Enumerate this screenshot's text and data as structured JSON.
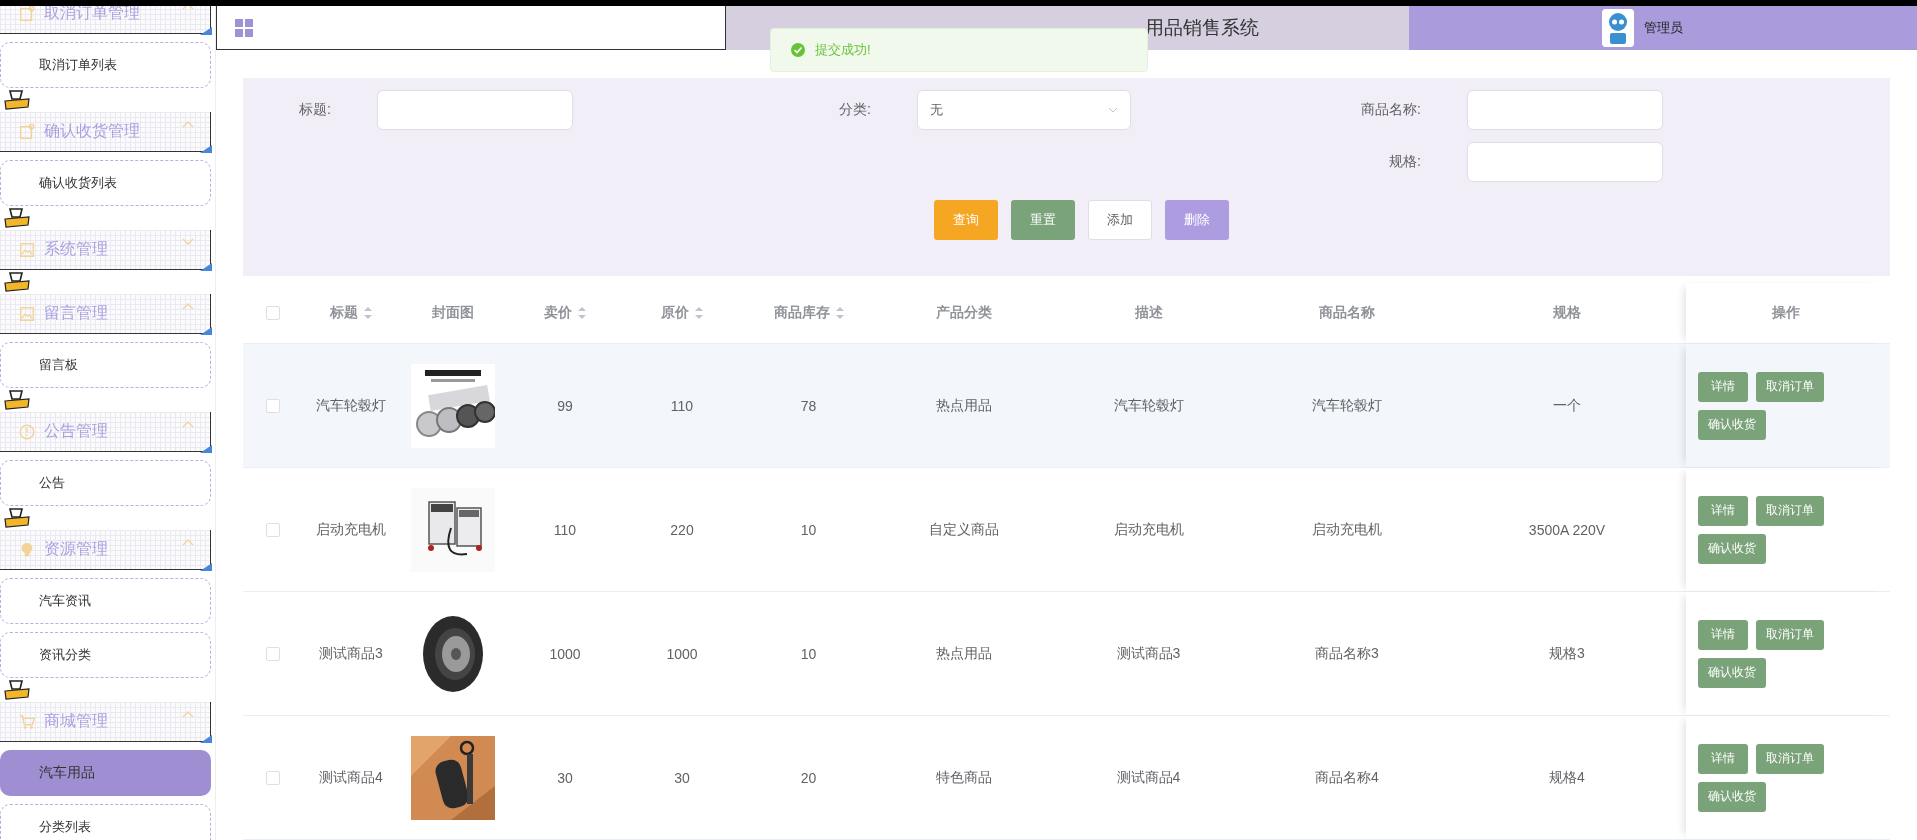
{
  "sidebar": {
    "groups": [
      {
        "title": "取消订单管理",
        "expanded": true,
        "items": [
          {
            "label": "取消订单列表",
            "selected": false
          }
        ]
      },
      {
        "title": "确认收货管理",
        "expanded": true,
        "items": [
          {
            "label": "确认收货列表",
            "selected": false
          }
        ]
      },
      {
        "title": "系统管理",
        "expanded": false
      },
      {
        "title": "留言管理",
        "expanded": true,
        "items": [
          {
            "label": "留言板",
            "selected": false
          }
        ]
      },
      {
        "title": "公告管理",
        "expanded": true,
        "items": [
          {
            "label": "公告",
            "selected": false
          }
        ]
      },
      {
        "title": "资源管理",
        "expanded": true,
        "items": [
          {
            "label": "汽车资讯",
            "selected": false
          },
          {
            "label": "资讯分类",
            "selected": false
          }
        ]
      },
      {
        "title": "商城管理",
        "expanded": true,
        "items": [
          {
            "label": "汽车用品",
            "selected": true
          },
          {
            "label": "分类列表",
            "selected": false
          }
        ]
      }
    ]
  },
  "header": {
    "title": "用品销售系统",
    "user": "管理员"
  },
  "toast": {
    "message": "提交成功!"
  },
  "filters": {
    "fields": [
      {
        "kind": "input",
        "label": "标题:"
      },
      {
        "kind": "select",
        "label": "分类:",
        "value": "无"
      },
      {
        "kind": "input",
        "label": "商品名称:"
      },
      {
        "kind": "input",
        "label": "规格:"
      }
    ],
    "buttons": [
      {
        "kind": "query",
        "label": "查询"
      },
      {
        "kind": "reset",
        "label": "重置"
      },
      {
        "kind": "add",
        "label": "添加"
      },
      {
        "kind": "delete",
        "label": "删除"
      }
    ]
  },
  "table": {
    "all_checked": false,
    "columns": [
      {
        "label": "标题",
        "sortable": true
      },
      {
        "label": "封面图",
        "sortable": false
      },
      {
        "label": "卖价",
        "sortable": true
      },
      {
        "label": "原价",
        "sortable": true
      },
      {
        "label": "商品库存",
        "sortable": true
      },
      {
        "label": "产品分类",
        "sortable": false
      },
      {
        "label": "描述",
        "sortable": false
      },
      {
        "label": "商品名称",
        "sortable": false
      },
      {
        "label": "规格",
        "sortable": false
      }
    ],
    "actions_label": "操作",
    "rows": [
      {
        "checked": false,
        "hovered": true,
        "cells": [
          "汽车轮毂灯",
          "",
          "99",
          "110",
          "78",
          "热点用品",
          "汽车轮毂灯",
          "汽车轮毂灯",
          "一个"
        ],
        "actions": [
          "详情",
          "取消订单",
          "确认收货"
        ]
      },
      {
        "checked": false,
        "hovered": false,
        "cells": [
          "启动充电机",
          "",
          "110",
          "220",
          "10",
          "自定义商品",
          "启动充电机",
          "启动充电机",
          "3500A 220V"
        ],
        "actions": [
          "详情",
          "取消订单",
          "确认收货"
        ]
      },
      {
        "checked": false,
        "hovered": false,
        "cells": [
          "测试商品3",
          "",
          "1000",
          "1000",
          "10",
          "热点用品",
          "测试商品3",
          "商品名称3",
          "规格3"
        ],
        "actions": [
          "详情",
          "取消订单",
          "确认收货"
        ]
      },
      {
        "checked": false,
        "hovered": false,
        "cells": [
          "测试商品4",
          "",
          "30",
          "30",
          "20",
          "特色商品",
          "测试商品4",
          "商品名称4",
          "规格4"
        ],
        "actions": [
          "详情",
          "取消订单",
          "确认收货"
        ]
      }
    ]
  }
}
